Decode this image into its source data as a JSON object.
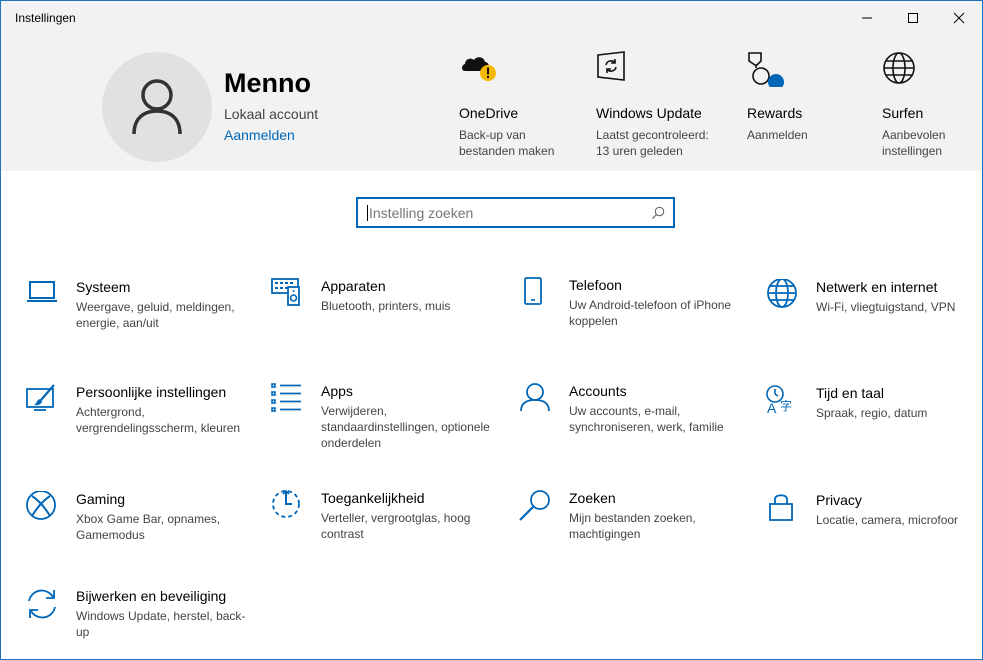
{
  "window": {
    "title": "Instellingen"
  },
  "account": {
    "name": "Menno",
    "type": "Lokaal account",
    "signin_label": "Aanmelden"
  },
  "quick_links": [
    {
      "icon": "onedrive-warning-icon",
      "title": "OneDrive",
      "desc1": "Back-up van",
      "desc2": "bestanden maken"
    },
    {
      "icon": "windows-update-icon",
      "title": "Windows Update",
      "desc1": "Laatst gecontroleerd:",
      "desc2": "13 uren geleden"
    },
    {
      "icon": "rewards-icon",
      "title": "Rewards",
      "desc1": "Aanmelden",
      "desc2": ""
    },
    {
      "icon": "globe-icon",
      "title": "Surfen",
      "desc1": "Aanbevolen",
      "desc2": "instellingen"
    }
  ],
  "search": {
    "placeholder": "Instelling zoeken"
  },
  "categories": [
    {
      "icon": "laptop-icon",
      "title": "Systeem",
      "desc": "Weergave, geluid, meldingen, energie, aan/uit"
    },
    {
      "icon": "devices-icon",
      "title": "Apparaten",
      "desc": "Bluetooth, printers, muis"
    },
    {
      "icon": "phone-icon",
      "title": "Telefoon",
      "desc": "Uw Android-telefoon of iPhone koppelen"
    },
    {
      "icon": "network-globe-icon",
      "title": "Netwerk en internet",
      "desc": "Wi-Fi, vliegtuigstand, VPN"
    },
    {
      "icon": "personalization-icon",
      "title": "Persoonlijke instellingen",
      "desc": "Achtergrond, vergrendelingsscherm, kleuren"
    },
    {
      "icon": "apps-list-icon",
      "title": "Apps",
      "desc": "Verwijderen, standaardinstellingen, optionele onderdelen"
    },
    {
      "icon": "person-icon",
      "title": "Accounts",
      "desc": "Uw accounts, e-mail, synchroniseren, werk, familie"
    },
    {
      "icon": "time-language-icon",
      "title": "Tijd en taal",
      "desc": "Spraak, regio, datum"
    },
    {
      "icon": "xbox-icon",
      "title": "Gaming",
      "desc": "Xbox Game Bar, opnames, Gamemodus"
    },
    {
      "icon": "accessibility-timer-icon",
      "title": "Toegankelijkheid",
      "desc": "Verteller, vergrootglas, hoog contrast"
    },
    {
      "icon": "search-magnifier-icon",
      "title": "Zoeken",
      "desc": "Mijn bestanden zoeken, machtigingen"
    },
    {
      "icon": "lock-icon",
      "title": "Privacy",
      "desc": "Locatie, camera, microfoor"
    },
    {
      "icon": "sync-arrows-icon",
      "title": "Bijwerken en beveiliging",
      "desc": "Windows Update, herstel, back-up"
    }
  ],
  "colors": {
    "accent": "#0067b8",
    "header_bg": "#f2f2f2",
    "warning": "#f5b800"
  }
}
